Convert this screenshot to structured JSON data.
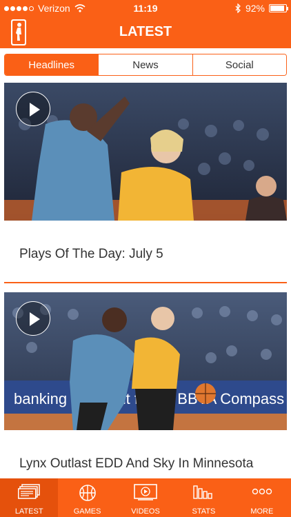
{
  "status_bar": {
    "carrier": "Verizon",
    "time": "11:19",
    "battery": "92%",
    "battery_level": 0.92
  },
  "nav": {
    "title": "LATEST",
    "logo": "wnba-logo"
  },
  "segments": [
    {
      "label": "Headlines",
      "active": true
    },
    {
      "label": "News",
      "active": false
    },
    {
      "label": "Social",
      "active": false
    }
  ],
  "articles": [
    {
      "headline": "Plays Of The Day: July 5",
      "video": true
    },
    {
      "headline": "Lynx Outlast EDD And Sky In Minnesota",
      "video": true
    }
  ],
  "court_ad": "banking on bright future  BBVA Compass",
  "tabs": [
    {
      "label": "LATEST",
      "icon": "news-stack-icon",
      "active": true
    },
    {
      "label": "GAMES",
      "icon": "basketball-icon",
      "active": false
    },
    {
      "label": "VIDEOS",
      "icon": "video-play-icon",
      "active": false
    },
    {
      "label": "STATS",
      "icon": "bar-stats-icon",
      "active": false
    },
    {
      "label": "MORE",
      "icon": "more-dots-icon",
      "active": false
    }
  ],
  "colors": {
    "brand": "#fa6016",
    "brand_dark": "#e5510c",
    "text": "#333333"
  }
}
